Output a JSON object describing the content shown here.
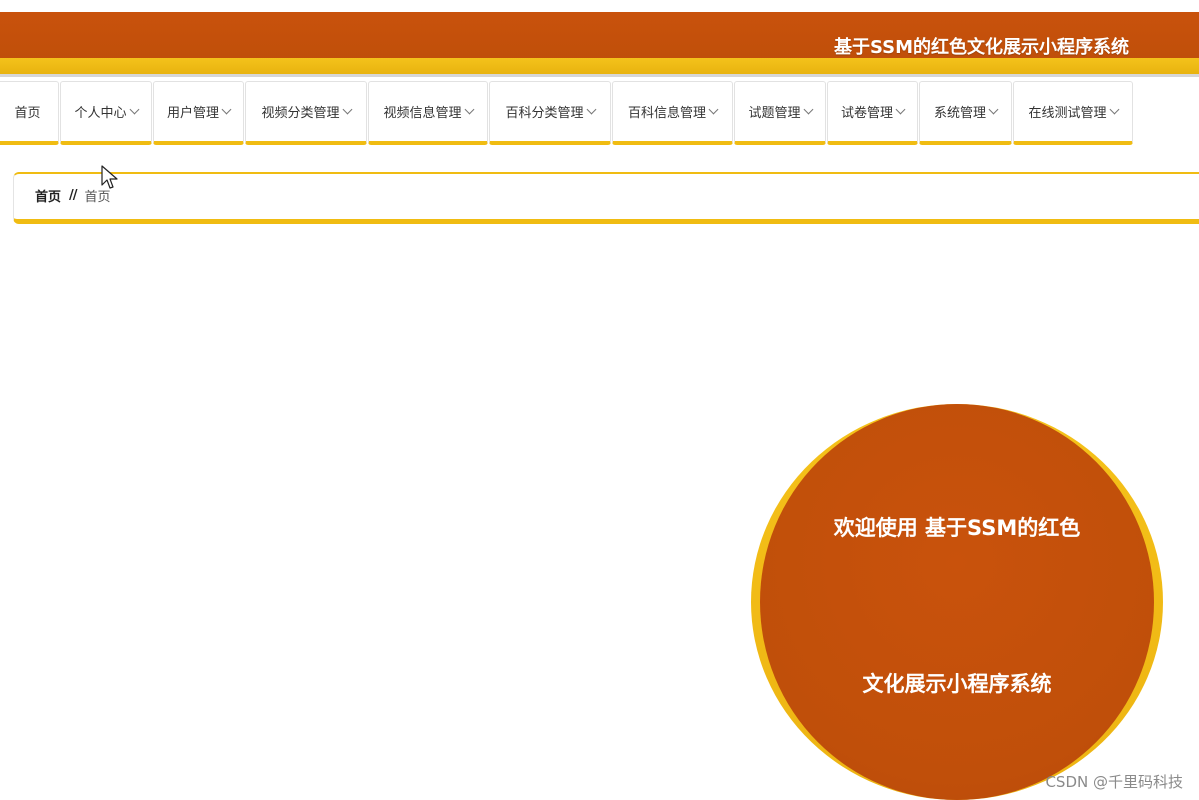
{
  "header": {
    "title": "基于SSM的红色文化展示小程序系统"
  },
  "nav": {
    "items": [
      {
        "label": "首页",
        "has_dropdown": false
      },
      {
        "label": "个人中心",
        "has_dropdown": true
      },
      {
        "label": "用户管理",
        "has_dropdown": true
      },
      {
        "label": "视频分类管理",
        "has_dropdown": true
      },
      {
        "label": "视频信息管理",
        "has_dropdown": true
      },
      {
        "label": "百科分类管理",
        "has_dropdown": true
      },
      {
        "label": "百科信息管理",
        "has_dropdown": true
      },
      {
        "label": "试题管理",
        "has_dropdown": true
      },
      {
        "label": "试卷管理",
        "has_dropdown": true
      },
      {
        "label": "系统管理",
        "has_dropdown": true
      },
      {
        "label": "在线测试管理",
        "has_dropdown": true
      }
    ]
  },
  "breadcrumb": {
    "home": "首页",
    "separator": "//",
    "current": "首页"
  },
  "welcome": {
    "line1": "欢迎使用 基于SSM的红色",
    "line2": "文化展示小程序系统"
  },
  "watermark": "CSDN @千里码科技",
  "colors": {
    "primary": "#c04f0a",
    "accent": "#f0bc12",
    "text": "#333333"
  }
}
